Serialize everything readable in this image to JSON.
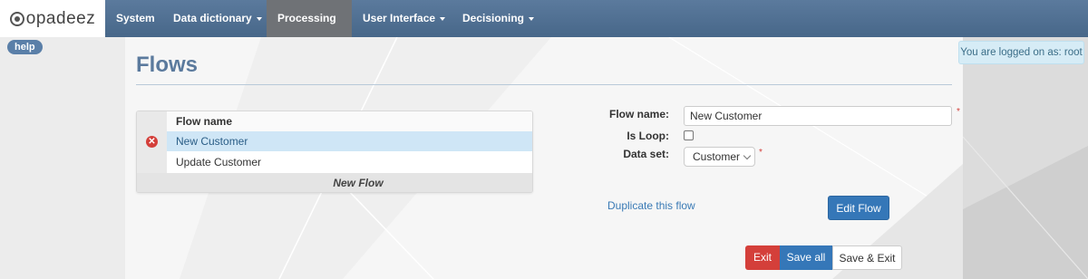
{
  "nav": {
    "logo_text": "opadeez",
    "items": [
      {
        "label": "System",
        "has_caret": false
      },
      {
        "label": "Data dictionary",
        "has_caret": true
      },
      {
        "label": "Processing",
        "has_caret": true,
        "active": true
      },
      {
        "label": "User Interface",
        "has_caret": true
      },
      {
        "label": "Decisioning",
        "has_caret": true
      }
    ]
  },
  "help_label": "help",
  "login_status": "You are logged on as: root",
  "page_title": "Flows",
  "flows_table": {
    "header": "Flow name",
    "rows": [
      {
        "name": "New Customer",
        "selected": true
      },
      {
        "name": "Update Customer",
        "selected": false
      }
    ],
    "footer_action": "New Flow",
    "delete_icon": "delete-circle-icon"
  },
  "form": {
    "flow_name_label": "Flow name:",
    "flow_name_value": "New Customer",
    "is_loop_label": "Is Loop:",
    "is_loop_checked": false,
    "data_set_label": "Data set:",
    "data_set_value": "Customer",
    "required_marker": "*"
  },
  "actions": {
    "duplicate_link": "Duplicate this flow",
    "edit_flow": "Edit Flow",
    "exit": "Exit",
    "save_all": "Save all",
    "save_exit": "Save & Exit"
  },
  "colors": {
    "nav_bg": "#4f6f92",
    "nav_active": "#6f7276",
    "title": "#5b7a9d",
    "primary": "#3577b8",
    "danger": "#d43f3a",
    "selected_row": "#cfe6f6"
  }
}
